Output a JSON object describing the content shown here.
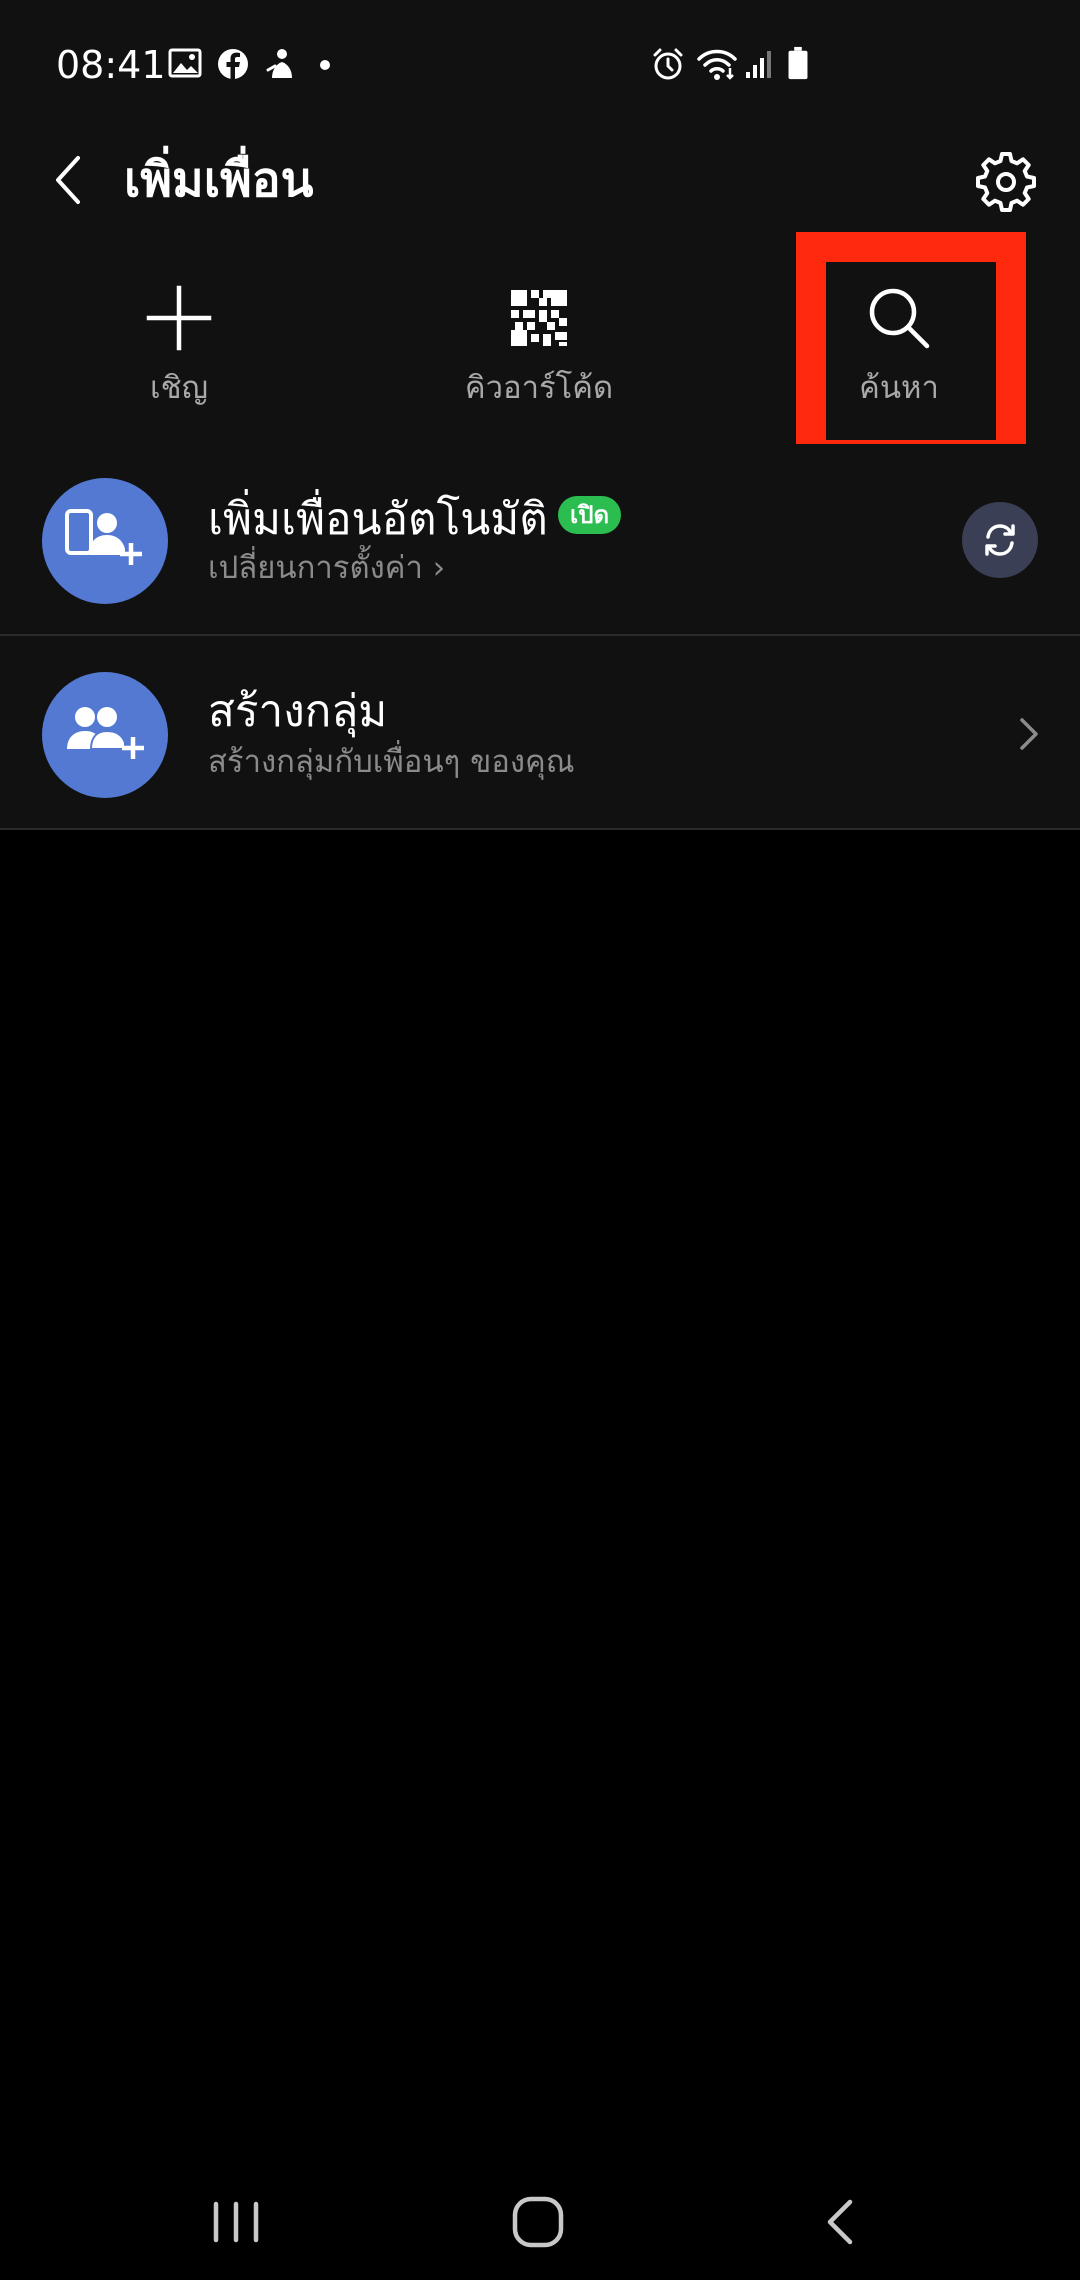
{
  "status_bar": {
    "time": "08:41",
    "icons": [
      "gallery-icon",
      "facebook-icon",
      "bixby-icon",
      "alarm-icon",
      "wifi-icon",
      "signal-icon",
      "battery-icon"
    ]
  },
  "header": {
    "title": "เพิ่มเพื่อน",
    "back_icon": "chevron-left-icon",
    "settings_icon": "gear-icon"
  },
  "actions": [
    {
      "label": "เชิญ",
      "icon": "plus-icon"
    },
    {
      "label": "คิวอาร์โค้ด",
      "icon": "qr-code-icon"
    },
    {
      "label": "ค้นหา",
      "icon": "search-icon"
    }
  ],
  "list": {
    "auto_add": {
      "title": "เพิ่มเพื่อนอัตโนมัติ",
      "badge": "เปิด",
      "subtitle": "เปลี่ยนการตั้งค่า ›",
      "icon": "phone-add-friend-icon",
      "action_icon": "sync-icon"
    },
    "create_group": {
      "title": "สร้างกลุ่ม",
      "subtitle": "สร้างกลุ่มกับเพื่อนๆ ของคุณ",
      "icon": "group-add-icon",
      "action_icon": "chevron-right-icon"
    }
  },
  "nav_bar": {
    "icons": [
      "recent-apps-icon",
      "home-icon",
      "back-icon"
    ]
  },
  "colors": {
    "background": "#111111",
    "accent_avatar": "#5379d2",
    "badge_green": "#2bbd4f",
    "highlight_red": "#ff2a0e"
  }
}
